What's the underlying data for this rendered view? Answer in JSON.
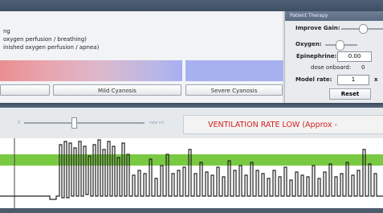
{
  "legend": {
    "line1": "ng",
    "line2": "oxygen perfusion / breathing)",
    "line3": "inished oxygen perfusion / apnea)"
  },
  "buttons": {
    "mild_cyanosis": "Mild Cyanosis",
    "severe_cyanosis": "Severe Cyanosis"
  },
  "right_panel": {
    "title": "Patient Therapy",
    "improve_gain_label": "Improve Gain:",
    "oxygen_label": "Oxygen:",
    "epinephrine_label": "Epinephrine:",
    "epinephrine_value": "0.00",
    "dose_onboard_label": "dose onboard:",
    "dose_onboard_value": "0",
    "model_rate_label": "Model rate:",
    "model_rate_value": "1",
    "model_rate_suffix": "x",
    "reset": "Reset"
  },
  "ventilation": {
    "slider_left_label": "0",
    "slider_right_label": "rate ctl",
    "alert": "VENTILATION RATE LOW (Approx -"
  },
  "colors": {
    "alert_red": "#d42020",
    "green_band": "#7ac943",
    "trace": "#222222"
  }
}
